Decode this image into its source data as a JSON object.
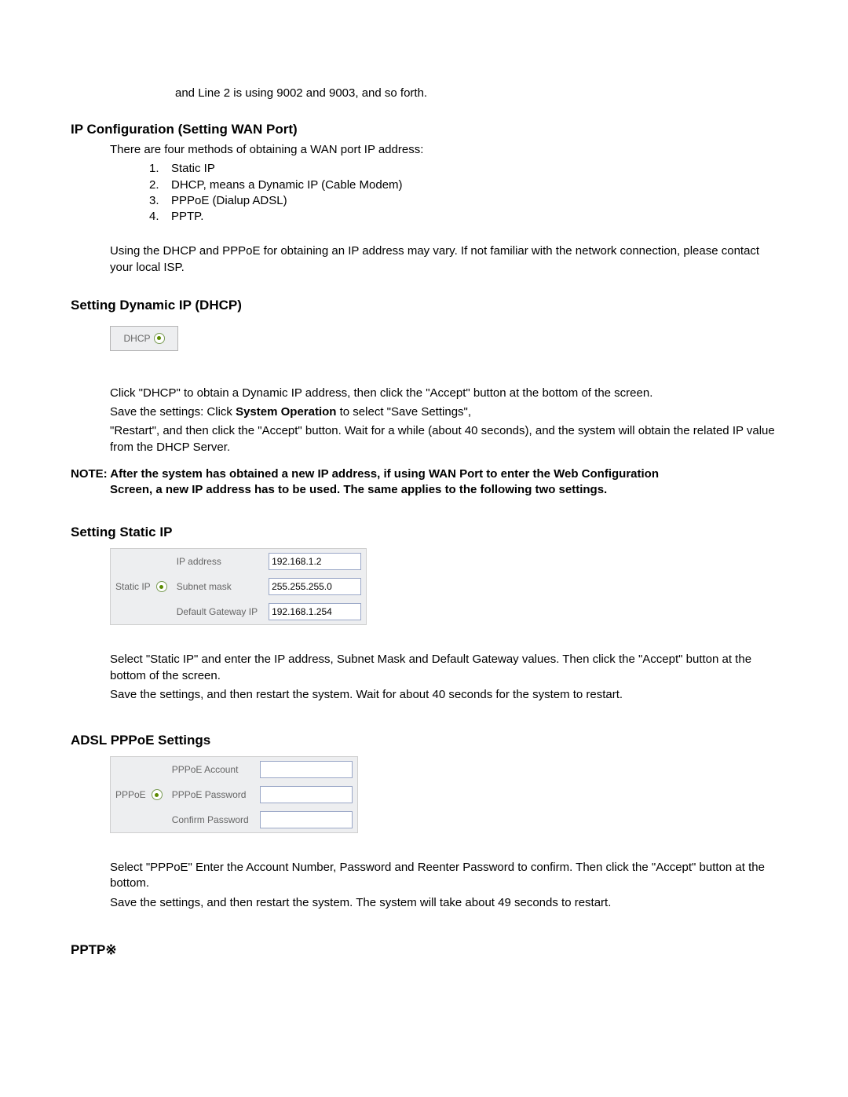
{
  "intro_line": "and Line 2 is using 9002 and 9003, and so forth.",
  "sections": {
    "ip_config": {
      "heading": "IP Configuration (Setting WAN Port)",
      "intro": "There are four methods of obtaining a WAN port IP address:",
      "methods": [
        "Static IP",
        "DHCP, means a Dynamic IP (Cable Modem)",
        "PPPoE (Dialup ADSL)",
        "PPTP."
      ],
      "para2": "Using the DHCP and PPPoE for obtaining an IP address may vary. If not familiar with the network connection, please contact your local ISP."
    },
    "dhcp": {
      "heading": "Setting Dynamic IP (DHCP)",
      "box_label": "DHCP",
      "para1a": "Click \"DHCP\" to obtain a Dynamic IP address, then click the \"Accept\" button at the bottom of the screen.",
      "para1b_prefix": "Save the settings:   Click ",
      "para1b_bold": "System Operation",
      "para1b_suffix": " to select \"Save Settings\",",
      "para1c": "\"Restart\", and then click the \"Accept\" button. Wait for a while (about 40 seconds), and the system will obtain the related IP value from the DHCP Server.",
      "note_line1": "NOTE: After the system has obtained a new IP address, if using WAN Port to enter the Web Configuration",
      "note_line2": "Screen, a new IP address has to be used. The same applies to the following two settings."
    },
    "static": {
      "heading": "Setting Static IP",
      "radio_label": "Static IP",
      "row1_label": "IP address",
      "row1_value": "192.168.1.2",
      "row2_label": "Subnet mask",
      "row2_value": "255.255.255.0",
      "row3_label": "Default Gateway IP",
      "row3_value": "192.168.1.254",
      "para1": "Select \"Static IP\" and enter the IP address, Subnet Mask and Default Gateway values. Then click the \"Accept\" button at the bottom of the screen.",
      "para2": "Save the settings, and then restart the system. Wait for about 40 seconds for the system to restart."
    },
    "pppoe": {
      "heading": "ADSL PPPoE Settings",
      "radio_label": "PPPoE",
      "row1_label": "PPPoE Account",
      "row2_label": "PPPoE Password",
      "row3_label": "Confirm Password",
      "para1": "Select \"PPPoE\" Enter the Account Number, Password and Reenter Password to confirm. Then click the \"Accept\" button at the bottom.",
      "para2": "Save the settings, and then restart the system. The system will take about 49 seconds to restart."
    },
    "pptp": {
      "heading": "PPTP※"
    }
  }
}
